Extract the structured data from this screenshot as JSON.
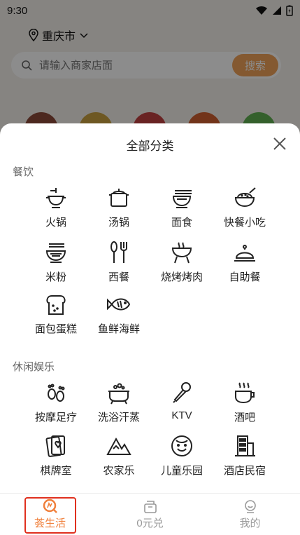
{
  "status_bar": {
    "time": "9:30"
  },
  "header": {
    "city": "重庆市"
  },
  "search": {
    "placeholder": "请输入商家店面",
    "button_label": "搜索"
  },
  "sheet": {
    "title": "全部分类",
    "sections": [
      {
        "title": "餐饮",
        "items": [
          "火锅",
          "汤锅",
          "面食",
          "快餐小吃",
          "米粉",
          "西餐",
          "烧烤烤肉",
          "自助餐",
          "面包蛋糕",
          "鱼鲜海鲜"
        ]
      },
      {
        "title": "休闲娱乐",
        "items": [
          "按摩足疗",
          "洗浴汗蒸",
          "KTV",
          "酒吧",
          "棋牌室",
          "农家乐",
          "儿童乐园",
          "酒店民宿"
        ]
      }
    ]
  },
  "nav": {
    "items": [
      "荟生活",
      "0元兑",
      "我的"
    ],
    "active_index": 0
  },
  "colors": {
    "accent": "#f0803c",
    "search_button": "#f0a35a",
    "highlight": "#e0301e"
  }
}
